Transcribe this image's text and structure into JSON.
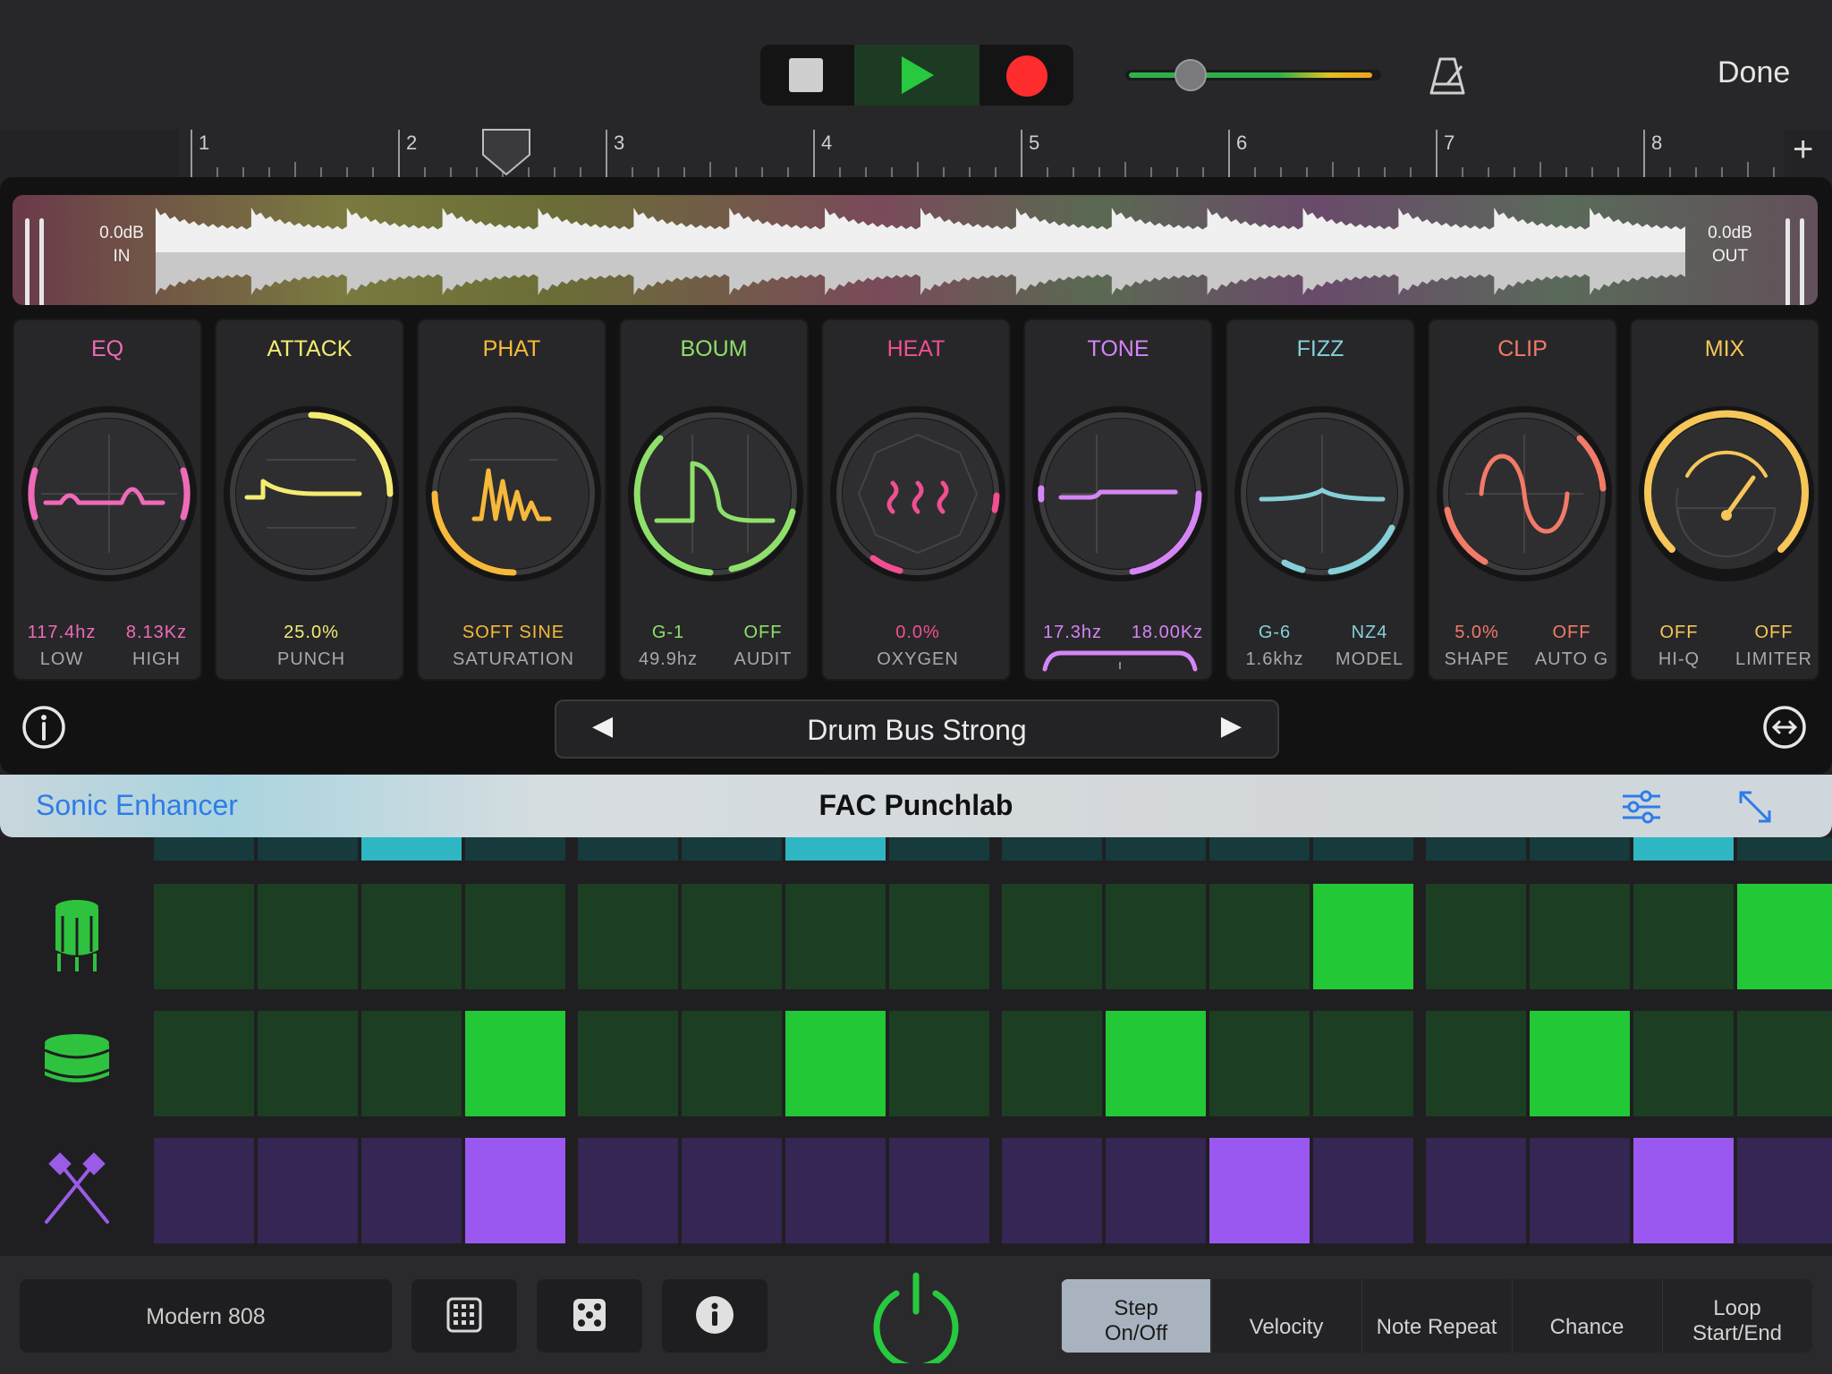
{
  "header": {
    "done_label": "Done",
    "volume_level": 0.22,
    "ruler_marks": [
      "1",
      "2",
      "3",
      "4",
      "5",
      "6",
      "7",
      "8"
    ],
    "add_label": "+"
  },
  "plugin": {
    "input_level": "0.0dB",
    "input_label": "IN",
    "output_level": "0.0dB",
    "output_label": "OUT",
    "modules": [
      {
        "title": "EQ",
        "color": "#f06ab8",
        "values": [
          {
            "value": "117.4hz",
            "label": "LOW"
          },
          {
            "value": "8.13Kz",
            "label": "HIGH"
          }
        ]
      },
      {
        "title": "ATTACK",
        "color": "#f3ec72",
        "values": [
          {
            "value": "25.0%",
            "label": "PUNCH"
          }
        ]
      },
      {
        "title": "PHAT",
        "color": "#f7b93b",
        "values": [
          {
            "value": "SOFT SINE",
            "label": "SATURATION"
          }
        ]
      },
      {
        "title": "BOUM",
        "color": "#8fe06a",
        "values": [
          {
            "value": "G-1",
            "label": "49.9hz"
          },
          {
            "value": "OFF",
            "label": "AUDIT"
          }
        ]
      },
      {
        "title": "HEAT",
        "color": "#f04f92",
        "values": [
          {
            "value": "0.0%",
            "label": "OXYGEN"
          }
        ]
      },
      {
        "title": "TONE",
        "color": "#d585f5",
        "values": [
          {
            "value": "17.3hz",
            "label": ""
          },
          {
            "value": "18.00Kz",
            "label": ""
          }
        ]
      },
      {
        "title": "FIZZ",
        "color": "#85d0d8",
        "values": [
          {
            "value": "G-6",
            "label": "1.6khz"
          },
          {
            "value": "NZ4",
            "label": "MODEL"
          }
        ]
      },
      {
        "title": "CLIP",
        "color": "#f27a68",
        "values": [
          {
            "value": "5.0%",
            "label": "SHAPE"
          },
          {
            "value": "OFF",
            "label": "AUTO G"
          }
        ]
      },
      {
        "title": "MIX",
        "color": "#f6c659",
        "values": [
          {
            "value": "OFF",
            "label": "HI-Q"
          },
          {
            "value": "OFF",
            "label": "LIMITER"
          }
        ]
      }
    ],
    "preset_name": "Drum Bus Strong",
    "prev_glyph": "◀",
    "next_glyph": "▶"
  },
  "strip": {
    "left_label": "Sonic Enhancer",
    "title": "FAC Punchlab"
  },
  "sequencer": {
    "lanes": [
      {
        "name": "tom",
        "icon": "tom-drum-icon",
        "color": "#2fc23e",
        "on_color": "#22c835",
        "off_color": "#1c3e22",
        "steps": [
          0,
          0,
          0,
          0,
          0,
          0,
          0,
          0,
          0,
          0,
          0,
          1,
          0,
          0,
          0,
          1
        ]
      },
      {
        "name": "snare",
        "icon": "snare-drum-icon",
        "color": "#2fc23e",
        "on_color": "#22c835",
        "off_color": "#1c3e22",
        "steps": [
          0,
          0,
          0,
          1,
          0,
          0,
          1,
          0,
          0,
          1,
          0,
          0,
          0,
          1,
          0,
          0
        ]
      },
      {
        "name": "sticks",
        "icon": "drumsticks-icon",
        "color": "#9a5ce6",
        "on_color": "#9b58f0",
        "off_color": "#352654",
        "steps": [
          0,
          0,
          0,
          1,
          0,
          0,
          0,
          0,
          0,
          0,
          1,
          0,
          0,
          0,
          1,
          0
        ]
      }
    ],
    "top_lane": {
      "on_color": "#2eb6c2",
      "off_color": "#173a3c",
      "steps": [
        0,
        0,
        1,
        0,
        0,
        0,
        1,
        0,
        0,
        0,
        0,
        0,
        0,
        0,
        1,
        0
      ]
    }
  },
  "bottom": {
    "kit_name": "Modern 808",
    "icons": [
      "grid-icon",
      "dice-icon",
      "info-icon"
    ],
    "modes": [
      {
        "line1": "Step",
        "line2": "On/Off",
        "selected": true
      },
      {
        "line1": "Velocity",
        "line2": "",
        "selected": false
      },
      {
        "line1": "Note Repeat",
        "line2": "",
        "selected": false
      },
      {
        "line1": "Chance",
        "line2": "",
        "selected": false
      },
      {
        "line1": "Loop",
        "line2": "Start/End",
        "selected": false
      }
    ]
  }
}
